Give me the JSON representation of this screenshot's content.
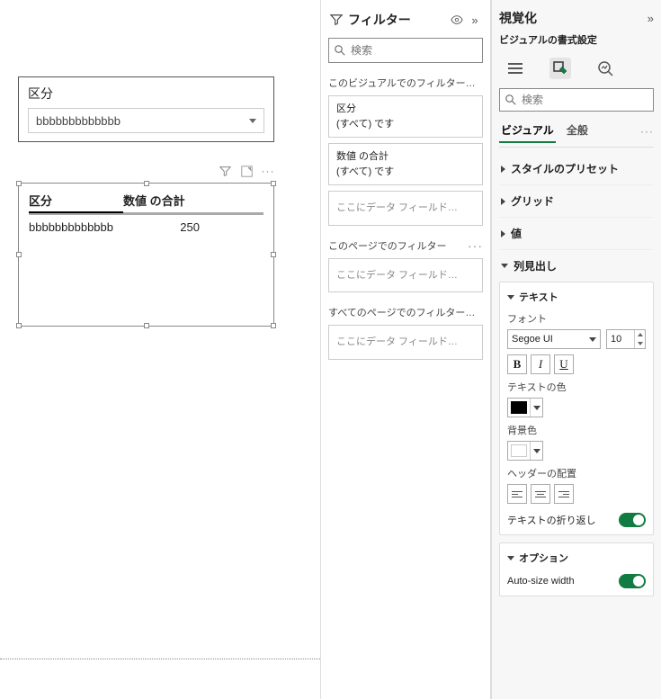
{
  "canvas": {
    "slicer": {
      "title": "区分",
      "value": "bbbbbbbbbbbbb"
    },
    "table": {
      "columns": [
        "区分",
        "数値 の合計"
      ],
      "rows": [
        {
          "c1": "bbbbbbbbbbbbb",
          "c2": "250"
        }
      ]
    }
  },
  "filters": {
    "title": "フィルター",
    "search_placeholder": "検索",
    "s1_label": "このビジュアルでのフィルター…",
    "card1_t": "区分",
    "card1_s": "(すべて) です",
    "card2_t": "数値 の合計",
    "card2_s": "(すべて) です",
    "drop_text": "ここにデータ フィールド…",
    "s2_label": "このページでのフィルター",
    "s3_label": "すべてのページでのフィルター…"
  },
  "viz": {
    "title": "視覚化",
    "subtitle": "ビジュアルの書式設定",
    "search_placeholder": "検索",
    "tab_visual": "ビジュアル",
    "tab_general": "全般",
    "acc_style": "スタイルのプリセット",
    "acc_grid": "グリッド",
    "acc_values": "値",
    "acc_colhead": "列見出し",
    "text_section": "テキスト",
    "font_label": "フォント",
    "font_name": "Segoe UI",
    "font_size": "10",
    "text_color_label": "テキストの色",
    "bg_color_label": "背景色",
    "align_label": "ヘッダーの配置",
    "wrap_label": "テキストの折り返し",
    "option_section": "オプション",
    "autosize_label": "Auto-size width"
  },
  "colors": {
    "text_color": "#000000",
    "bg_color": "#ffffff",
    "accent": "#107c41"
  },
  "chart_data": {
    "type": "table",
    "columns": [
      "区分",
      "数値 の合計"
    ],
    "rows": [
      [
        "bbbbbbbbbbbbb",
        250
      ]
    ]
  }
}
